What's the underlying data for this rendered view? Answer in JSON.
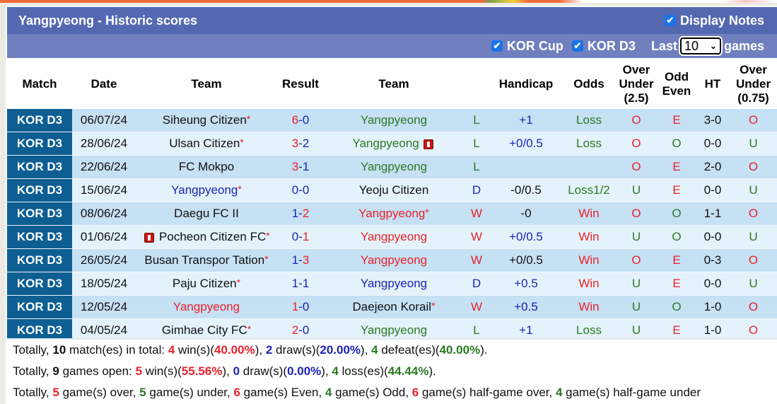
{
  "header": {
    "title": "Yangpyeong - Historic scores",
    "display_notes_label": "Display Notes",
    "display_notes_checked": true
  },
  "filters": {
    "kor_cup_label": "KOR Cup",
    "kor_cup_checked": true,
    "kor_d3_label": "KOR D3",
    "kor_d3_checked": true,
    "last_label": "Last",
    "games_select_value": "10",
    "games_label": "games"
  },
  "columns": [
    "Match",
    "Date",
    "Team",
    "Result",
    "Team",
    "Handicap",
    "Odds",
    "Over Under (2.5)",
    "Odd Even",
    "HT",
    "Over Under (0.75)"
  ],
  "column_lines": {
    "ou25": [
      "Over",
      "Under",
      "(2.5)"
    ],
    "oddeven": [
      "Odd",
      "Even"
    ],
    "ou075": [
      "Over",
      "Under",
      "(0.75)"
    ]
  },
  "colors": {
    "title_bar": "#5468b2",
    "filter_bar": "#7080be",
    "league_cell": "#0d5e92",
    "row_odd": "#c6e0f4",
    "row_even": "#e4f2fb",
    "red": "#e8232a",
    "blue": "#1f23b5",
    "green": "#2a7a22"
  },
  "rows": [
    {
      "league": "KOR D3",
      "date": "06/07/24",
      "home": "Siheung Citizen",
      "home_star": true,
      "home_color": "black",
      "home_card": false,
      "score_home": "6",
      "score_away": "0",
      "score_home_color": "red",
      "score_away_color": "blue",
      "away": "Yangpyeong",
      "away_star": false,
      "away_color": "green",
      "away_card": false,
      "wl": "L",
      "wl_color": "green",
      "handicap": "+1",
      "handicap_color": "blue",
      "odds": "Loss",
      "odds_color": "green",
      "ou": "O",
      "ou_color": "red",
      "oe": "E",
      "oe_color": "red",
      "ht": "3-0",
      "ou075": "O",
      "ou075_color": "red"
    },
    {
      "league": "KOR D3",
      "date": "28/06/24",
      "home": "Ulsan Citizen",
      "home_star": true,
      "home_color": "black",
      "home_card": false,
      "score_home": "3",
      "score_away": "2",
      "score_home_color": "red",
      "score_away_color": "blue",
      "away": "Yangpyeong",
      "away_star": false,
      "away_color": "green",
      "away_card": true,
      "wl": "L",
      "wl_color": "green",
      "handicap": "+0/0.5",
      "handicap_color": "blue",
      "odds": "Loss",
      "odds_color": "green",
      "ou": "O",
      "ou_color": "red",
      "oe": "O",
      "oe_color": "green",
      "ht": "0-0",
      "ou075": "U",
      "ou075_color": "green"
    },
    {
      "league": "KOR D3",
      "date": "22/06/24",
      "home": "FC Mokpo",
      "home_star": false,
      "home_color": "black",
      "home_card": false,
      "score_home": "3",
      "score_away": "1",
      "score_home_color": "red",
      "score_away_color": "blue",
      "away": "Yangpyeong",
      "away_star": false,
      "away_color": "green",
      "away_card": false,
      "wl": "L",
      "wl_color": "green",
      "handicap": "",
      "handicap_color": "blue",
      "odds": "",
      "odds_color": "green",
      "ou": "O",
      "ou_color": "red",
      "oe": "E",
      "oe_color": "red",
      "ht": "2-0",
      "ou075": "O",
      "ou075_color": "red"
    },
    {
      "league": "KOR D3",
      "date": "15/06/24",
      "home": "Yangpyeong",
      "home_star": true,
      "home_color": "blue",
      "home_card": false,
      "score_home": "0",
      "score_away": "0",
      "score_home_color": "blue",
      "score_away_color": "blue",
      "away": "Yeoju Citizen",
      "away_star": false,
      "away_color": "black",
      "away_card": false,
      "wl": "D",
      "wl_color": "blue",
      "handicap": "-0/0.5",
      "handicap_color": "black",
      "odds": "Loss1/2",
      "odds_color": "green",
      "ou": "U",
      "ou_color": "green",
      "oe": "E",
      "oe_color": "red",
      "ht": "0-0",
      "ou075": "U",
      "ou075_color": "green"
    },
    {
      "league": "KOR D3",
      "date": "08/06/24",
      "home": "Daegu FC II",
      "home_star": false,
      "home_color": "black",
      "home_card": false,
      "score_home": "1",
      "score_away": "2",
      "score_home_color": "blue",
      "score_away_color": "red",
      "away": "Yangpyeong",
      "away_star": true,
      "away_color": "red",
      "away_card": false,
      "wl": "W",
      "wl_color": "red",
      "handicap": "-0",
      "handicap_color": "black",
      "odds": "Win",
      "odds_color": "red",
      "ou": "O",
      "ou_color": "red",
      "oe": "O",
      "oe_color": "green",
      "ht": "1-1",
      "ou075": "O",
      "ou075_color": "red"
    },
    {
      "league": "KOR D3",
      "date": "01/06/24",
      "home": "Pocheon Citizen FC",
      "home_star": true,
      "home_color": "black",
      "home_card": true,
      "score_home": "0",
      "score_away": "1",
      "score_home_color": "blue",
      "score_away_color": "red",
      "away": "Yangpyeong",
      "away_star": false,
      "away_color": "red",
      "away_card": false,
      "wl": "W",
      "wl_color": "red",
      "handicap": "+0/0.5",
      "handicap_color": "blue",
      "odds": "Win",
      "odds_color": "red",
      "ou": "U",
      "ou_color": "green",
      "oe": "O",
      "oe_color": "green",
      "ht": "0-0",
      "ou075": "U",
      "ou075_color": "green"
    },
    {
      "league": "KOR D3",
      "date": "26/05/24",
      "home": "Busan Transpor Tation",
      "home_star": true,
      "home_color": "black",
      "home_card": false,
      "score_home": "1",
      "score_away": "3",
      "score_home_color": "blue",
      "score_away_color": "red",
      "away": "Yangpyeong",
      "away_star": false,
      "away_color": "red",
      "away_card": false,
      "wl": "W",
      "wl_color": "red",
      "handicap": "+0/0.5",
      "handicap_color": "black",
      "odds": "Win",
      "odds_color": "red",
      "ou": "O",
      "ou_color": "red",
      "oe": "E",
      "oe_color": "red",
      "ht": "0-3",
      "ou075": "O",
      "ou075_color": "red"
    },
    {
      "league": "KOR D3",
      "date": "18/05/24",
      "home": "Paju Citizen",
      "home_star": true,
      "home_color": "black",
      "home_card": false,
      "score_home": "1",
      "score_away": "1",
      "score_home_color": "blue",
      "score_away_color": "blue",
      "away": "Yangpyeong",
      "away_star": false,
      "away_color": "blue",
      "away_card": false,
      "wl": "D",
      "wl_color": "blue",
      "handicap": "+0.5",
      "handicap_color": "blue",
      "odds": "Win",
      "odds_color": "red",
      "ou": "U",
      "ou_color": "green",
      "oe": "E",
      "oe_color": "red",
      "ht": "0-0",
      "ou075": "U",
      "ou075_color": "green"
    },
    {
      "league": "KOR D3",
      "date": "12/05/24",
      "home": "Yangpyeong",
      "home_star": false,
      "home_color": "red",
      "home_card": false,
      "score_home": "1",
      "score_away": "0",
      "score_home_color": "red",
      "score_away_color": "blue",
      "away": "Daejeon Korail",
      "away_star": true,
      "away_color": "black",
      "away_card": false,
      "wl": "W",
      "wl_color": "red",
      "handicap": "+0.5",
      "handicap_color": "blue",
      "odds": "Win",
      "odds_color": "red",
      "ou": "U",
      "ou_color": "green",
      "oe": "O",
      "oe_color": "green",
      "ht": "1-0",
      "ou075": "O",
      "ou075_color": "red"
    },
    {
      "league": "KOR D3",
      "date": "04/05/24",
      "home": "Gimhae City FC",
      "home_star": true,
      "home_color": "black",
      "home_card": false,
      "score_home": "2",
      "score_away": "0",
      "score_home_color": "red",
      "score_away_color": "blue",
      "away": "Yangpyeong",
      "away_star": false,
      "away_color": "green",
      "away_card": false,
      "wl": "L",
      "wl_color": "green",
      "handicap": "+1",
      "handicap_color": "blue",
      "odds": "Loss",
      "odds_color": "green",
      "ou": "U",
      "ou_color": "green",
      "oe": "E",
      "oe_color": "red",
      "ht": "1-0",
      "ou075": "O",
      "ou075_color": "red"
    }
  ],
  "summary": {
    "line1": [
      {
        "t": "Totally, ",
        "c": "black",
        "b": false
      },
      {
        "t": "10",
        "c": "black",
        "b": true
      },
      {
        "t": " match(es) in total: ",
        "c": "black",
        "b": false
      },
      {
        "t": "4",
        "c": "red",
        "b": true
      },
      {
        "t": " win(s)(",
        "c": "black",
        "b": false
      },
      {
        "t": "40.00%",
        "c": "red",
        "b": true
      },
      {
        "t": "), ",
        "c": "black",
        "b": false
      },
      {
        "t": "2",
        "c": "blue",
        "b": true
      },
      {
        "t": " draw(s)(",
        "c": "black",
        "b": false
      },
      {
        "t": "20.00%",
        "c": "blue",
        "b": true
      },
      {
        "t": "), ",
        "c": "black",
        "b": false
      },
      {
        "t": "4",
        "c": "green",
        "b": true
      },
      {
        "t": " defeat(es)(",
        "c": "black",
        "b": false
      },
      {
        "t": "40.00%",
        "c": "green",
        "b": true
      },
      {
        "t": ").",
        "c": "black",
        "b": false
      }
    ],
    "line2": [
      {
        "t": "Totally, ",
        "c": "black",
        "b": false
      },
      {
        "t": "9",
        "c": "black",
        "b": true
      },
      {
        "t": " games open: ",
        "c": "black",
        "b": false
      },
      {
        "t": "5",
        "c": "red",
        "b": true
      },
      {
        "t": " win(s)(",
        "c": "black",
        "b": false
      },
      {
        "t": "55.56%",
        "c": "red",
        "b": true
      },
      {
        "t": "), ",
        "c": "black",
        "b": false
      },
      {
        "t": "0",
        "c": "blue",
        "b": true
      },
      {
        "t": " draw(s)(",
        "c": "black",
        "b": false
      },
      {
        "t": "0.00%",
        "c": "blue",
        "b": true
      },
      {
        "t": "), ",
        "c": "black",
        "b": false
      },
      {
        "t": "4",
        "c": "green",
        "b": true
      },
      {
        "t": " loss(es)(",
        "c": "black",
        "b": false
      },
      {
        "t": "44.44%",
        "c": "green",
        "b": true
      },
      {
        "t": ").",
        "c": "black",
        "b": false
      }
    ],
    "line3": [
      {
        "t": "Totally, ",
        "c": "black",
        "b": false
      },
      {
        "t": "5",
        "c": "red",
        "b": true
      },
      {
        "t": " game(s) over, ",
        "c": "black",
        "b": false
      },
      {
        "t": "5",
        "c": "green",
        "b": true
      },
      {
        "t": " game(s) under, ",
        "c": "black",
        "b": false
      },
      {
        "t": "6",
        "c": "red",
        "b": true
      },
      {
        "t": " game(s) Even, ",
        "c": "black",
        "b": false
      },
      {
        "t": "4",
        "c": "green",
        "b": true
      },
      {
        "t": " game(s) Odd, ",
        "c": "black",
        "b": false
      },
      {
        "t": "6",
        "c": "red",
        "b": true
      },
      {
        "t": " game(s) half-game over, ",
        "c": "black",
        "b": false
      },
      {
        "t": "4",
        "c": "green",
        "b": true
      },
      {
        "t": " game(s) half-game under",
        "c": "black",
        "b": false
      }
    ]
  }
}
